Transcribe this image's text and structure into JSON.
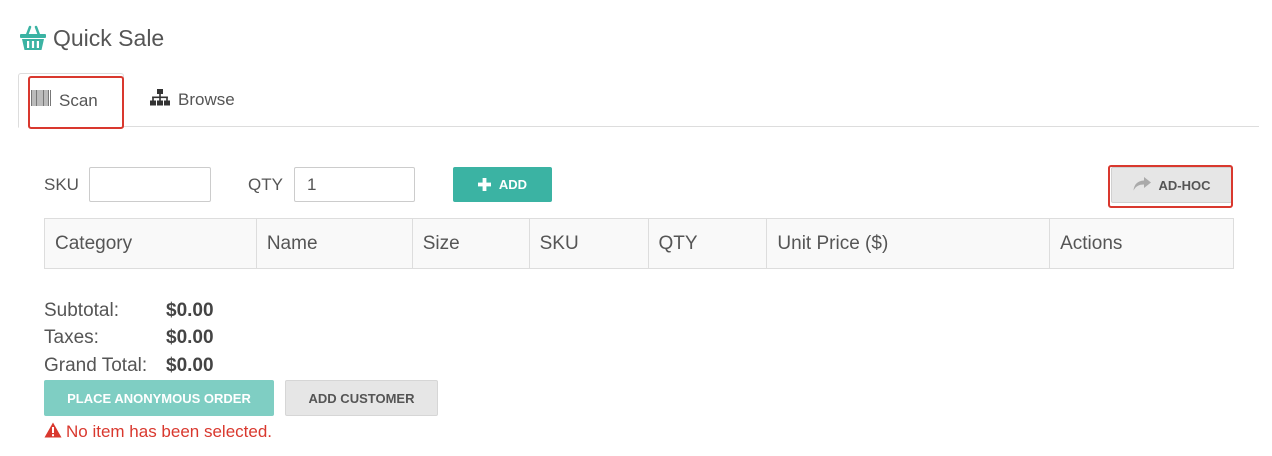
{
  "header": {
    "title": "Quick Sale",
    "icon": "basket-icon",
    "accent": "#3bb3a3"
  },
  "tabs": [
    {
      "label": "Scan",
      "icon": "barcode-icon",
      "active": true
    },
    {
      "label": "Browse",
      "icon": "sitemap-icon",
      "active": false
    }
  ],
  "form": {
    "sku_label": "SKU",
    "sku_value": "",
    "qty_label": "QTY",
    "qty_value": "1",
    "add_label": "ADD",
    "adhoc_label": "AD-HOC"
  },
  "table": {
    "columns": [
      "Category",
      "Name",
      "Size",
      "SKU",
      "QTY",
      "Unit Price ($)",
      "Actions"
    ],
    "rows": []
  },
  "totals": {
    "subtotal_label": "Subtotal:",
    "subtotal_value": "$0.00",
    "taxes_label": "Taxes:",
    "taxes_value": "$0.00",
    "grand_label": "Grand Total:",
    "grand_value": "$0.00"
  },
  "actions": {
    "place_order_label": "PLACE ANONYMOUS ORDER",
    "add_customer_label": "ADD CUSTOMER"
  },
  "status": {
    "error_message": "No item has been selected.",
    "error_color": "#d9382e"
  }
}
